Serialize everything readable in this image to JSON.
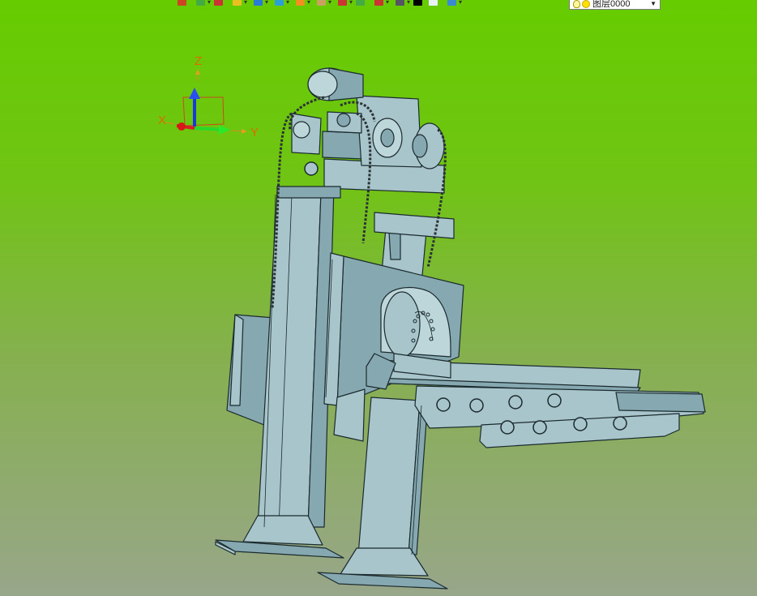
{
  "app": {
    "toolbar": {
      "buttons": [
        {
          "icon": "undo-icon",
          "color": "#cc4422",
          "has_dropdown": false
        },
        {
          "icon": "redo-icon",
          "color": "#44aa44",
          "has_dropdown": true
        },
        {
          "icon": "pencil-icon",
          "color": "#cc3333",
          "has_dropdown": false
        },
        {
          "icon": "box-yellow-icon",
          "color": "#e8c020",
          "has_dropdown": true
        },
        {
          "icon": "cube-blue-icon",
          "color": "#2a7ad8",
          "has_dropdown": true
        },
        {
          "icon": "cube-teal-icon",
          "color": "#2aa0d8",
          "has_dropdown": true
        },
        {
          "icon": "render-ball-icon",
          "color": "#f09020",
          "has_dropdown": true
        },
        {
          "icon": "clipboard-icon",
          "color": "#c8a060",
          "has_dropdown": true
        },
        {
          "icon": "move-axes-icon",
          "color": "#cc3333",
          "has_dropdown": true
        },
        {
          "icon": "sheet-green-icon",
          "color": "#44aa44",
          "has_dropdown": false
        },
        {
          "icon": "select-box-icon",
          "color": "#cc3333",
          "has_dropdown": true
        },
        {
          "icon": "monitor-icon",
          "color": "#555566",
          "has_dropdown": true
        },
        {
          "icon": "black-square-icon",
          "color": "#000000",
          "has_dropdown": false
        },
        {
          "icon": "white-square-icon",
          "color": "#e8f0f8",
          "has_dropdown": false
        },
        {
          "icon": "layers-icon",
          "color": "#3a8ad0",
          "has_dropdown": true
        }
      ],
      "layer_combo": {
        "value": "图层0000"
      }
    }
  },
  "axis_triad": {
    "x": "X",
    "y": "Y",
    "z": "Z"
  },
  "colors": {
    "model_fill": "#a7c5cb",
    "model_dark": "#7c9ea6",
    "model_edge": "#1b2a2e",
    "bg_top": "#66cc00",
    "bg_bottom": "#98a68a"
  }
}
